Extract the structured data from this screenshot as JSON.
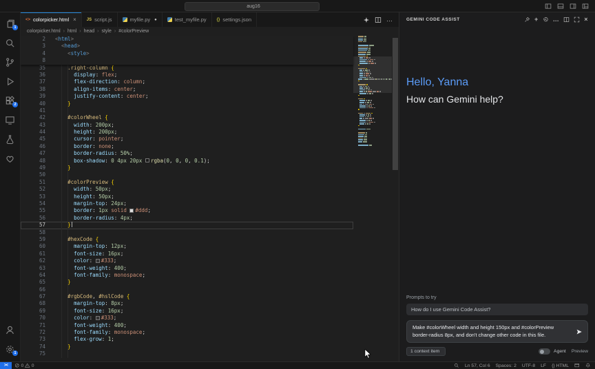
{
  "title_bar": {
    "search_value": "aug16",
    "nav_icons": [
      "arrow-left",
      "arrow-right"
    ],
    "layout_icons": [
      "layout-left",
      "layout-panel",
      "layout-right",
      "layout-custom"
    ]
  },
  "activity_bar": {
    "top": [
      {
        "name": "explorer",
        "icon": "files",
        "badge": "1"
      },
      {
        "name": "search",
        "icon": "search"
      },
      {
        "name": "source-control",
        "icon": "git"
      },
      {
        "name": "run-debug",
        "icon": "debug"
      },
      {
        "name": "extensions",
        "icon": "extensions",
        "badge": "2"
      },
      {
        "name": "remote-explorer",
        "icon": "remote"
      },
      {
        "name": "testing",
        "icon": "beaker"
      },
      {
        "name": "gemini",
        "icon": "heart"
      }
    ],
    "bottom": [
      {
        "name": "accounts",
        "icon": "account"
      },
      {
        "name": "settings",
        "icon": "gear",
        "badge": "1"
      }
    ]
  },
  "tabs": [
    {
      "label": "colorpicker.html",
      "icon": "html",
      "active": true,
      "close": true
    },
    {
      "label": "script.js",
      "icon": "js"
    },
    {
      "label": "myfile.py",
      "icon": "py",
      "modified": true
    },
    {
      "label": "test_myfile.py",
      "icon": "py"
    },
    {
      "label": "settings.json",
      "icon": "json"
    }
  ],
  "tab_actions": [
    "sparkle",
    "split",
    "more"
  ],
  "breadcrumb": [
    "colorpicker.html",
    "html",
    "head",
    "style",
    "#colorPreview"
  ],
  "editor": {
    "current_line": 57,
    "sticky": [
      {
        "n": 2,
        "t": [
          [
            "ab",
            "<"
          ],
          [
            "tg",
            "html"
          ],
          [
            "ab",
            ">"
          ]
        ]
      },
      {
        "n": 3,
        "t": [
          [
            "pl",
            "  "
          ],
          [
            "ab",
            "<"
          ],
          [
            "tg",
            "head"
          ],
          [
            "ab",
            ">"
          ]
        ]
      },
      {
        "n": 4,
        "t": [
          [
            "pl",
            "    "
          ],
          [
            "ab",
            "<"
          ],
          [
            "tg",
            "style"
          ],
          [
            "ab",
            ">"
          ]
        ]
      },
      {
        "n": 8,
        "t": []
      }
    ],
    "lines": [
      {
        "n": 35,
        "t": [
          [
            "pl",
            "    "
          ],
          [
            "se",
            ".right-column "
          ],
          [
            "br",
            "{"
          ]
        ]
      },
      {
        "n": 36,
        "t": [
          [
            "pl",
            "      "
          ],
          [
            "pr",
            "display"
          ],
          [
            "pu",
            ": "
          ],
          [
            "va",
            "flex"
          ],
          [
            "pu",
            ";"
          ]
        ]
      },
      {
        "n": 37,
        "t": [
          [
            "pl",
            "      "
          ],
          [
            "pr",
            "flex-direction"
          ],
          [
            "pu",
            ": "
          ],
          [
            "va",
            "column"
          ],
          [
            "pu",
            ";"
          ]
        ]
      },
      {
        "n": 38,
        "t": [
          [
            "pl",
            "      "
          ],
          [
            "pr",
            "align-items"
          ],
          [
            "pu",
            ": "
          ],
          [
            "va",
            "center"
          ],
          [
            "pu",
            ";"
          ]
        ]
      },
      {
        "n": 39,
        "t": [
          [
            "pl",
            "      "
          ],
          [
            "pr",
            "justify-content"
          ],
          [
            "pu",
            ": "
          ],
          [
            "va",
            "center"
          ],
          [
            "pu",
            ";"
          ]
        ]
      },
      {
        "n": 40,
        "t": [
          [
            "pl",
            "    "
          ],
          [
            "br",
            "}"
          ]
        ]
      },
      {
        "n": 41,
        "t": []
      },
      {
        "n": 42,
        "t": [
          [
            "pl",
            "    "
          ],
          [
            "se",
            "#colorWheel "
          ],
          [
            "br",
            "{"
          ]
        ]
      },
      {
        "n": 43,
        "t": [
          [
            "pl",
            "      "
          ],
          [
            "pr",
            "width"
          ],
          [
            "pu",
            ": "
          ],
          [
            "nu",
            "200px"
          ],
          [
            "pu",
            ";"
          ]
        ]
      },
      {
        "n": 44,
        "t": [
          [
            "pl",
            "      "
          ],
          [
            "pr",
            "height"
          ],
          [
            "pu",
            ": "
          ],
          [
            "nu",
            "200px"
          ],
          [
            "pu",
            ";"
          ]
        ]
      },
      {
        "n": 45,
        "t": [
          [
            "pl",
            "      "
          ],
          [
            "pr",
            "cursor"
          ],
          [
            "pu",
            ": "
          ],
          [
            "va",
            "pointer"
          ],
          [
            "pu",
            ";"
          ]
        ]
      },
      {
        "n": 46,
        "t": [
          [
            "pl",
            "      "
          ],
          [
            "pr",
            "border"
          ],
          [
            "pu",
            ": "
          ],
          [
            "va",
            "none"
          ],
          [
            "pu",
            ";"
          ]
        ]
      },
      {
        "n": 47,
        "t": [
          [
            "pl",
            "      "
          ],
          [
            "pr",
            "border-radius"
          ],
          [
            "pu",
            ": "
          ],
          [
            "nu",
            "50%"
          ],
          [
            "pu",
            ";"
          ]
        ]
      },
      {
        "n": 48,
        "t": [
          [
            "pl",
            "      "
          ],
          [
            "pr",
            "box-shadow"
          ],
          [
            "pu",
            ": "
          ],
          [
            "nu",
            "0 4px 20px "
          ],
          [
            "sw",
            "rgba(0,0,0,0.1)"
          ],
          [
            "fn",
            "rgba"
          ],
          [
            "pu",
            "("
          ],
          [
            "nu",
            "0"
          ],
          [
            "pu",
            ", "
          ],
          [
            "nu",
            "0"
          ],
          [
            "pu",
            ", "
          ],
          [
            "nu",
            "0"
          ],
          [
            "pu",
            ", "
          ],
          [
            "nu",
            "0.1"
          ],
          [
            "pu",
            ");"
          ]
        ]
      },
      {
        "n": 49,
        "t": [
          [
            "pl",
            "    "
          ],
          [
            "br",
            "}"
          ]
        ]
      },
      {
        "n": 50,
        "t": []
      },
      {
        "n": 51,
        "t": [
          [
            "pl",
            "    "
          ],
          [
            "se",
            "#colorPreview "
          ],
          [
            "br",
            "{"
          ]
        ]
      },
      {
        "n": 52,
        "t": [
          [
            "pl",
            "      "
          ],
          [
            "pr",
            "width"
          ],
          [
            "pu",
            ": "
          ],
          [
            "nu",
            "50px"
          ],
          [
            "pu",
            ";"
          ]
        ]
      },
      {
        "n": 53,
        "t": [
          [
            "pl",
            "      "
          ],
          [
            "pr",
            "height"
          ],
          [
            "pu",
            ": "
          ],
          [
            "nu",
            "50px"
          ],
          [
            "pu",
            ";"
          ]
        ]
      },
      {
        "n": 54,
        "t": [
          [
            "pl",
            "      "
          ],
          [
            "pr",
            "margin-top"
          ],
          [
            "pu",
            ": "
          ],
          [
            "nu",
            "24px"
          ],
          [
            "pu",
            ";"
          ]
        ]
      },
      {
        "n": 55,
        "t": [
          [
            "pl",
            "      "
          ],
          [
            "pr",
            "border"
          ],
          [
            "pu",
            ": "
          ],
          [
            "nu",
            "1px"
          ],
          [
            "va",
            " solid "
          ],
          [
            "sw",
            "#dddddd"
          ],
          [
            "va",
            "#ddd"
          ],
          [
            "pu",
            ";"
          ]
        ]
      },
      {
        "n": 56,
        "t": [
          [
            "pl",
            "      "
          ],
          [
            "pr",
            "border-radius"
          ],
          [
            "pu",
            ": "
          ],
          [
            "nu",
            "4px"
          ],
          [
            "pu",
            ";"
          ]
        ]
      },
      {
        "n": 57,
        "t": [
          [
            "pl",
            "    "
          ],
          [
            "br",
            "}"
          ]
        ]
      },
      {
        "n": 58,
        "t": []
      },
      {
        "n": 59,
        "t": [
          [
            "pl",
            "    "
          ],
          [
            "se",
            "#hexCode "
          ],
          [
            "br",
            "{"
          ]
        ]
      },
      {
        "n": 60,
        "t": [
          [
            "pl",
            "      "
          ],
          [
            "pr",
            "margin-top"
          ],
          [
            "pu",
            ": "
          ],
          [
            "nu",
            "12px"
          ],
          [
            "pu",
            ";"
          ]
        ]
      },
      {
        "n": 61,
        "t": [
          [
            "pl",
            "      "
          ],
          [
            "pr",
            "font-size"
          ],
          [
            "pu",
            ": "
          ],
          [
            "nu",
            "16px"
          ],
          [
            "pu",
            ";"
          ]
        ]
      },
      {
        "n": 62,
        "t": [
          [
            "pl",
            "      "
          ],
          [
            "pr",
            "color"
          ],
          [
            "pu",
            ": "
          ],
          [
            "sw",
            "#333333"
          ],
          [
            "va",
            "#333"
          ],
          [
            "pu",
            ";"
          ]
        ]
      },
      {
        "n": 63,
        "t": [
          [
            "pl",
            "      "
          ],
          [
            "pr",
            "font-weight"
          ],
          [
            "pu",
            ": "
          ],
          [
            "nu",
            "400"
          ],
          [
            "pu",
            ";"
          ]
        ]
      },
      {
        "n": 64,
        "t": [
          [
            "pl",
            "      "
          ],
          [
            "pr",
            "font-family"
          ],
          [
            "pu",
            ": "
          ],
          [
            "va",
            "monospace"
          ],
          [
            "pu",
            ";"
          ]
        ]
      },
      {
        "n": 65,
        "t": [
          [
            "pl",
            "    "
          ],
          [
            "br",
            "}"
          ]
        ]
      },
      {
        "n": 66,
        "t": []
      },
      {
        "n": 67,
        "t": [
          [
            "pl",
            "    "
          ],
          [
            "se",
            "#rgbCode"
          ],
          [
            "pu",
            ", "
          ],
          [
            "se",
            "#hslCode "
          ],
          [
            "br",
            "{"
          ]
        ]
      },
      {
        "n": 68,
        "t": [
          [
            "pl",
            "      "
          ],
          [
            "pr",
            "margin-top"
          ],
          [
            "pu",
            ": "
          ],
          [
            "nu",
            "8px"
          ],
          [
            "pu",
            ";"
          ]
        ]
      },
      {
        "n": 69,
        "t": [
          [
            "pl",
            "      "
          ],
          [
            "pr",
            "font-size"
          ],
          [
            "pu",
            ": "
          ],
          [
            "nu",
            "16px"
          ],
          [
            "pu",
            ";"
          ]
        ]
      },
      {
        "n": 70,
        "t": [
          [
            "pl",
            "      "
          ],
          [
            "pr",
            "color"
          ],
          [
            "pu",
            ": "
          ],
          [
            "sw",
            "#333333"
          ],
          [
            "va",
            "#333"
          ],
          [
            "pu",
            ";"
          ]
        ]
      },
      {
        "n": 71,
        "t": [
          [
            "pl",
            "      "
          ],
          [
            "pr",
            "font-weight"
          ],
          [
            "pu",
            ": "
          ],
          [
            "nu",
            "400"
          ],
          [
            "pu",
            ";"
          ]
        ]
      },
      {
        "n": 72,
        "t": [
          [
            "pl",
            "      "
          ],
          [
            "pr",
            "font-family"
          ],
          [
            "pu",
            ": "
          ],
          [
            "va",
            "monospace"
          ],
          [
            "pu",
            ";"
          ]
        ]
      },
      {
        "n": 73,
        "t": [
          [
            "pl",
            "      "
          ],
          [
            "pr",
            "flex-grow"
          ],
          [
            "pu",
            ": "
          ],
          [
            "nu",
            "1"
          ],
          [
            "pu",
            ";"
          ]
        ]
      },
      {
        "n": 74,
        "t": [
          [
            "pl",
            "    "
          ],
          [
            "br",
            "}"
          ]
        ]
      },
      {
        "n": 75,
        "t": []
      }
    ]
  },
  "gemini": {
    "header": "GEMINI CODE ASSIST",
    "header_icons": [
      "pin",
      "plus",
      "history",
      "more",
      "split",
      "expand",
      "close"
    ],
    "greeting": "Hello, Yanna",
    "subtitle": "How can Gemini help?",
    "prompts_label": "Prompts to try",
    "suggestion": "How do I use Gemini Code Assist?",
    "input_value": "Make #colorWheel width and height 150px and #colorPreview border-radius 8px, and don't change other code in this file.",
    "context_chip": "1 context item",
    "agent_label": "Agent",
    "preview_label": "Preview"
  },
  "status_bar": {
    "errors": "0",
    "warnings": "0",
    "right": [
      {
        "name": "zoom-indicator",
        "icon": "search"
      },
      {
        "name": "cursor-position",
        "label": "Ln 57, Col 6"
      },
      {
        "name": "indentation",
        "label": "Spaces: 2"
      },
      {
        "name": "encoding",
        "label": "UTF-8"
      },
      {
        "name": "eol",
        "label": "LF"
      },
      {
        "name": "language-mode",
        "label": "{} HTML"
      },
      {
        "name": "editor-preview",
        "icon": "preview"
      },
      {
        "name": "notifications",
        "icon": "bell"
      }
    ]
  }
}
